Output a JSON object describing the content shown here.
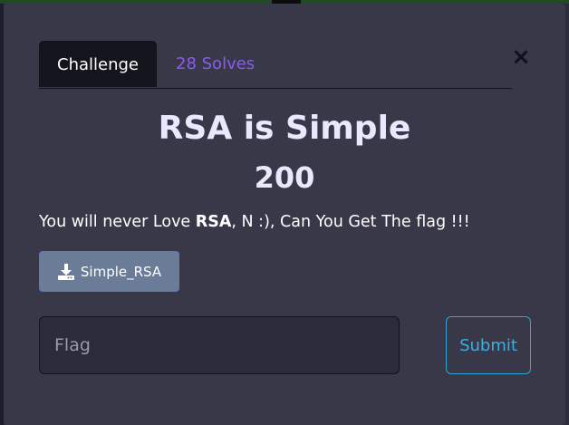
{
  "modal": {
    "tabs": [
      {
        "label": "Challenge"
      },
      {
        "label": "28 Solves"
      }
    ],
    "close_symbol": "×",
    "title": "RSA is Simple",
    "points": "200",
    "description": {
      "before": "You will never Love ",
      "bold": "RSA",
      "after": ", N :), Can You Get The flag !!!"
    },
    "file": {
      "label": "Simple_RSA",
      "icon": "download-icon"
    },
    "flag_input": {
      "placeholder": "Flag",
      "value": ""
    },
    "submit_label": "Submit"
  },
  "colors": {
    "modal_bg": "#383849",
    "tab_active_bg": "#14141c",
    "solves_link": "#8a5bf0",
    "file_button_bg": "#6a7c98",
    "submit_accent": "#2fa4d8"
  }
}
